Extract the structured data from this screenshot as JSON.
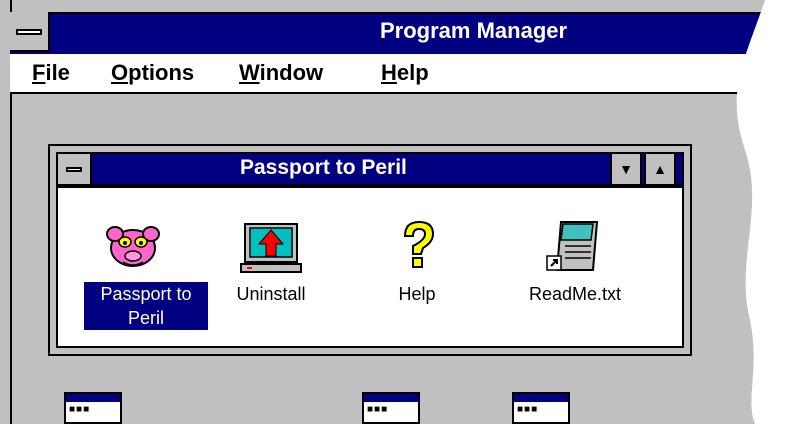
{
  "program_manager": {
    "title": "Program Manager",
    "menu": [
      {
        "label": "File",
        "mnemonic": "F",
        "rest": "ile"
      },
      {
        "label": "Options",
        "mnemonic": "O",
        "rest": "ptions"
      },
      {
        "label": "Window",
        "mnemonic": "W",
        "rest": "indow"
      },
      {
        "label": "Help",
        "mnemonic": "H",
        "rest": "elp"
      }
    ]
  },
  "group_window": {
    "title": "Passport to Peril",
    "items": [
      {
        "label_line1": "Passport to",
        "label_line2": "Peril",
        "icon": "pink-panther-icon",
        "selected": true
      },
      {
        "label_line1": "Uninstall",
        "icon": "uninstall-computer-icon",
        "selected": false
      },
      {
        "label_line1": "Help",
        "icon": "question-mark-icon",
        "selected": false
      },
      {
        "label_line1": "ReadMe.txt",
        "icon": "notepad-shortcut-icon",
        "selected": false
      }
    ]
  },
  "colors": {
    "title_bar": "#000080",
    "window_bg": "#c0c0c0",
    "client_bg": "#ffffff"
  }
}
